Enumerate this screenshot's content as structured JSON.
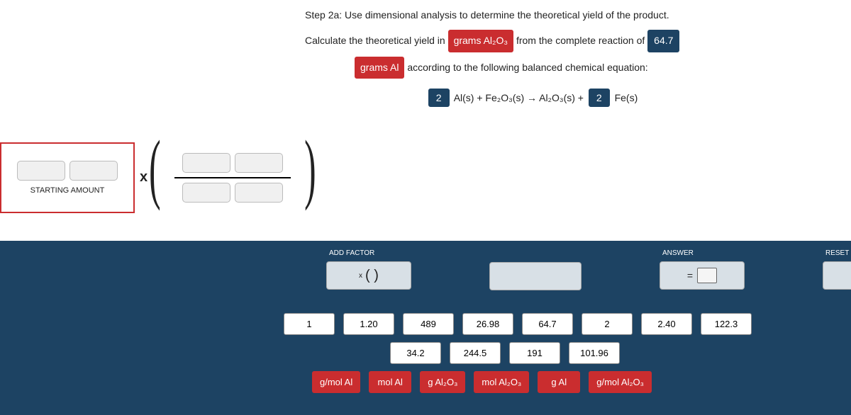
{
  "step_title": "Step 2a: Use dimensional analysis to determine the theoretical yield of the product.",
  "line1_a": "Calculate the theoretical yield in",
  "chip_grams_al2o3": "grams Al₂O₃",
  "line1_b": "from the complete reaction of",
  "chip_647": "64.7",
  "chip_grams_al": "grams Al",
  "line2_b": "according to the following balanced chemical equation:",
  "eq_coef1": "2",
  "eq_part1": "Al(s) + Fe₂O₃(s) → Al₂O₃(s) +",
  "eq_coef2": "2",
  "eq_part2": "Fe(s)",
  "starting_amount_label": "STARTING AMOUNT",
  "times": "x",
  "controls": {
    "add_factor": "ADD FACTOR",
    "add_x": "x",
    "add_parens": "(   )",
    "answer": "ANSWER",
    "equals": "=",
    "reset": "RESET"
  },
  "tiles_num": [
    "1",
    "1.20",
    "489",
    "26.98",
    "64.7",
    "2",
    "2.40",
    "122.3"
  ],
  "tiles_num2": [
    "34.2",
    "244.5",
    "191",
    "101.96"
  ],
  "tiles_unit": [
    "g/mol Al",
    "mol Al",
    "g Al₂O₃",
    "mol Al₂O₃",
    "g Al",
    "g/mol Al₂O₃"
  ]
}
